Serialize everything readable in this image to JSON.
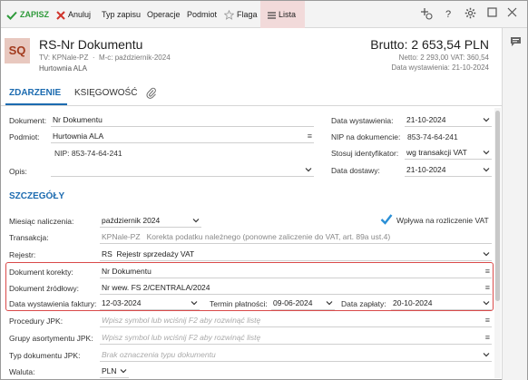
{
  "toolbar": {
    "save": "ZAPISZ",
    "cancel": "Anuluj",
    "type": "Typ zapisu",
    "operations": "Operacje",
    "subject": "Podmiot",
    "flag": "Flaga",
    "list": "Lista"
  },
  "header": {
    "avatar": "SQ",
    "title": "RS-Nr Dokumentu",
    "tv": "TV: KPNale-PZ",
    "mc": "M-c: październik-2024",
    "contractor": "Hurtownia ALA",
    "brutto": "Brutto: 2 653,54 PLN",
    "netto": "Netto: 2 293,00 VAT: 360,54",
    "data_wystawienia": "Data wystawienia: 21-10-2024"
  },
  "tabs": {
    "zdarzenie": "ZDARZENIE",
    "ksiegowosc": "KSIĘGOWOŚĆ"
  },
  "zdarzenie": {
    "dokument_label": "Dokument:",
    "dokument_value": "Nr Dokumentu",
    "podmiot_label": "Podmiot:",
    "podmiot_value": "Hurtownia ALA",
    "nip_value": "NIP:  853-74-64-241",
    "opis_label": "Opis:",
    "data_wyst_label": "Data wystawienia:",
    "data_wyst_value": "21-10-2024",
    "nip_dok_label": "NIP na dokumencie:",
    "nip_dok_value": "853-74-64-241",
    "stosuj_label": "Stosuj identyfikator:",
    "stosuj_value": "wg transakcji VAT",
    "data_dostawy_label": "Data dostawy:",
    "data_dostawy_value": "21-10-2024"
  },
  "szczegoly": {
    "title": "SZCZEGÓŁY",
    "miesiac_label": "Miesiąc naliczenia:",
    "miesiac_value": "październik 2024",
    "wplywa_label": "Wpływa na rozliczenie VAT",
    "transakcja_label": "Transakcja:",
    "transakcja_code": "KPNale-PZ",
    "transakcja_desc": "Korekta podatku należnego (ponowne zaliczenie do VAT, art. 89a ust.4)",
    "rejestr_label": "Rejestr:",
    "rejestr_code": "RS",
    "rejestr_desc": "Rejestr sprzedaży VAT",
    "dok_korekty_label": "Dokument korekty:",
    "dok_korekty_value": "Nr Dokumentu",
    "dok_zrodlowy_label": "Dokument źródłowy:",
    "dok_zrodlowy_value": "Nr wew. FS 2/CENTRALA/2024",
    "data_faktury_label": "Data wystawienia faktury:",
    "data_faktury_value": "12-03-2024",
    "termin_label": "Termin płatności:",
    "termin_value": "09-06-2024",
    "data_zaplaty_label": "Data zapłaty:",
    "data_zaplaty_value": "20-10-2024",
    "procedury_label": "Procedury JPK:",
    "procedury_ph": "Wpisz symbol lub wciśnij F2 aby rozwinąć listę",
    "grupy_label": "Grupy asortymentu JPK:",
    "grupy_ph": "Wpisz symbol lub wciśnij F2 aby rozwinąć listę",
    "typ_label": "Typ dokumentu JPK:",
    "typ_ph": "Brak oznaczenia typu dokumentu",
    "waluta_label": "Waluta:",
    "waluta_value": "PLN"
  },
  "colors": {
    "accent": "#1c6bb0",
    "highlight": "#d94a4a",
    "save": "#2e9a3a",
    "cancel": "#d0342c"
  }
}
